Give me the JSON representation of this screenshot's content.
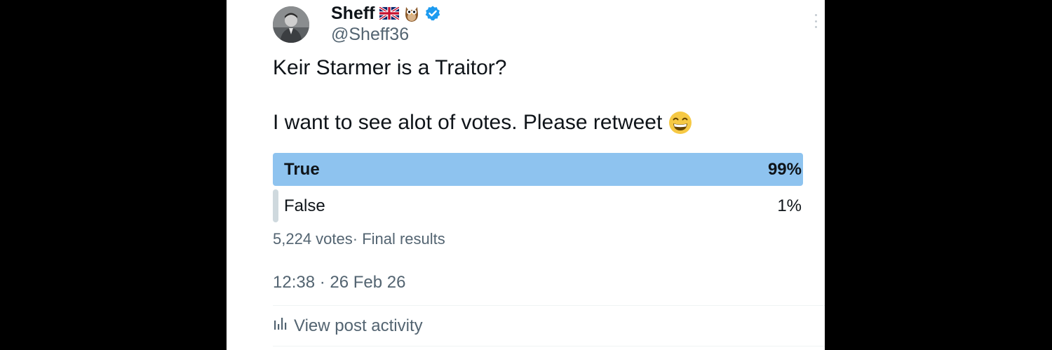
{
  "author": {
    "display_name": "Sheff",
    "handle": "@Sheff36",
    "badges": [
      "uk-flag-emoji",
      "owl-emoji",
      "verified-badge-icon"
    ],
    "verified_color": "#1d9bf0"
  },
  "tweet": {
    "line1": "Keir Starmer is a Traitor?",
    "line2": "I want to see alot of votes. Please retweet",
    "line2_emoji": "grinning-face-emoji"
  },
  "poll": {
    "options": [
      {
        "label": "True",
        "percent_text": "99%",
        "percent": 99,
        "winner": true
      },
      {
        "label": "False",
        "percent_text": "1%",
        "percent": 1,
        "winner": false
      }
    ],
    "votes": "5,224 votes",
    "status": "· Final results",
    "winner_color": "#8ec3ef",
    "other_color": "#cfd9de"
  },
  "timestamp": "12:38 · 26 Feb 26",
  "activity_label": "View post activity",
  "icons": {
    "more": "more-vertical-icon",
    "activity": "bar-chart-icon"
  }
}
